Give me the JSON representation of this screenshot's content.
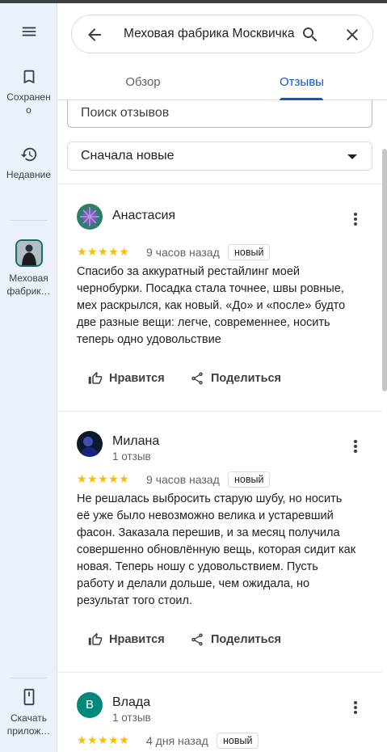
{
  "rail": {
    "menu_icon": "menu-icon",
    "saved_label": "Сохранено",
    "recent_label": "Недавние",
    "place_label": "Меховая фабрика Москвичка",
    "place_short": "Меховая фабрик…",
    "download_label": "Скачать прилож…"
  },
  "search": {
    "value": "Меховая фабрика Москвичка"
  },
  "tabs": {
    "overview": "Обзор",
    "reviews": "Отзывы",
    "active": "reviews"
  },
  "reviews_panel": {
    "search_placeholder": "Поиск отзывов",
    "sort_value": "Сначала новые"
  },
  "reviews": [
    {
      "author": "Анастасия",
      "subtitle": "",
      "rating": 5,
      "stars": "★★★★★",
      "time": "9 часов назад",
      "badge": "новый",
      "text": "Спасибо за аккуратный рестайлинг моей чернобурки. Посадка стала точнее, швы ровные, мех раскрылся, как новый. «До» и «после» будто две разные вещи: легче, современнее, носить теперь одно удовольствие",
      "like_label": "Нравится",
      "share_label": "Поделиться"
    },
    {
      "author": "Милана",
      "subtitle": "1 отзыв",
      "rating": 5,
      "stars": "★★★★★",
      "time": "9 часов назад",
      "badge": "новый",
      "text": "Не решалась выбросить старую шубу, но носить её уже было невозможно велика и устаревший фасон. Заказала перешив, и за месяц получила совершенно обновлённую вещь, которая сидит как новая. Теперь ношу с удовольствием. Пусть работу и делали дольше, чем ожидала, но результат того стоил.",
      "like_label": "Нравится",
      "share_label": "Поделиться"
    },
    {
      "author": "Влада",
      "avatar_letter": "В",
      "avatar_color": "#00897b",
      "subtitle": "1 отзыв",
      "rating": 5,
      "stars": "★★★★★",
      "time": "4 дня назад",
      "badge": "новый"
    }
  ],
  "colors": {
    "accent": "#0b57d0",
    "star": "#fbbc04",
    "rail_bg": "#eaf1fb"
  }
}
